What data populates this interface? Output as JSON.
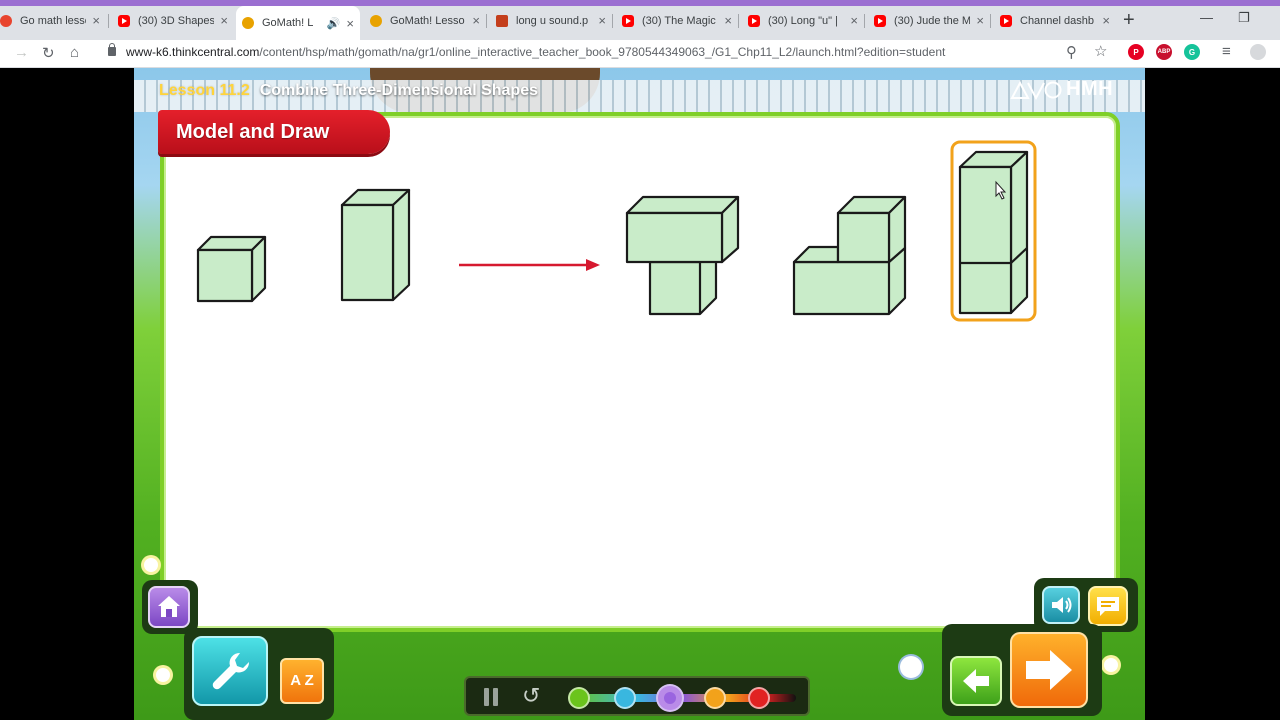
{
  "browser": {
    "tabs": [
      {
        "title": "Go math lesso",
        "icon": "red-icon",
        "active": false
      },
      {
        "title": "(30) 3D Shapes",
        "icon": "youtube-icon",
        "active": false
      },
      {
        "title": "GoMath! L",
        "icon": "gomath-icon",
        "active": true
      },
      {
        "title": "GoMath! Lesso",
        "icon": "gomath-icon",
        "active": false
      },
      {
        "title": "long u sound.p",
        "icon": "powerpoint-icon",
        "active": false
      },
      {
        "title": "(30) The Magic",
        "icon": "youtube-icon",
        "active": false
      },
      {
        "title": "(30) Long \"u\" |",
        "icon": "youtube-icon",
        "active": false
      },
      {
        "title": "(30) Jude the M",
        "icon": "youtube-icon",
        "active": false
      },
      {
        "title": "Channel dashb",
        "icon": "youtube-icon",
        "active": false
      }
    ],
    "url_host": "www-k6.thinkcentral.com",
    "url_path": "/content/hsp/math/gomath/na/gr1/online_interactive_teacher_book_9780544349063_/G1_Chp11_L2/launch.html?edition=student",
    "new_tab_symbol": "+",
    "close_symbol": "×"
  },
  "lesson": {
    "number": "Lesson 11.2",
    "title": "Combine Three-Dimensional Shapes",
    "publisher": "HMH",
    "section_banner": "Model and Draw"
  },
  "shapes": {
    "arrow_color": "#d6192f",
    "face_color": "#c9ecc9",
    "highlight_color": "#f2a21b"
  },
  "controls": {
    "home": "home-icon",
    "tools": "wrench-icon",
    "glossary": "A Z",
    "audio": "speaker-icon",
    "captions": "caption-icon",
    "prev": "arrow-left-icon",
    "next": "arrow-right-icon"
  }
}
